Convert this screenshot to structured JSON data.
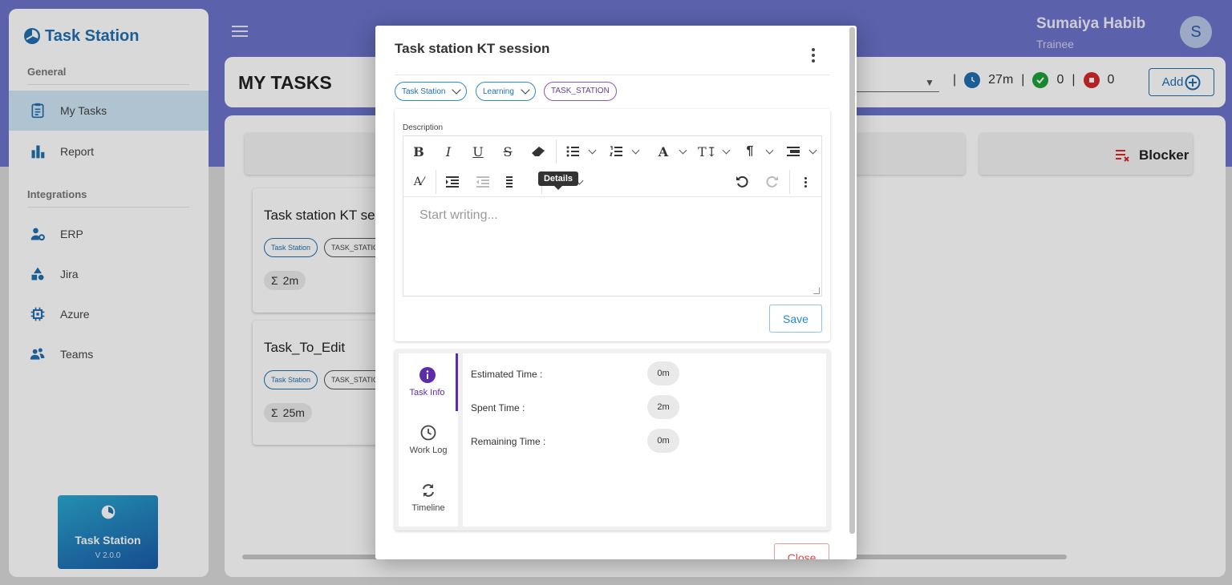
{
  "app": {
    "name": "Task Station",
    "version": "V 2.0.0"
  },
  "sidebar": {
    "sections": [
      {
        "title": "General",
        "items": [
          {
            "label": "My Tasks",
            "icon": "clipboard-icon",
            "active": true
          },
          {
            "label": "Report",
            "icon": "bar-chart-icon"
          }
        ]
      },
      {
        "title": "Integrations",
        "items": [
          {
            "label": "ERP",
            "icon": "user-gear-icon"
          },
          {
            "label": "Jira",
            "icon": "shapes-icon"
          },
          {
            "label": "Azure",
            "icon": "chip-icon"
          },
          {
            "label": "Teams",
            "icon": "team-icon"
          }
        ]
      }
    ]
  },
  "user": {
    "name": "Sumaiya Habib",
    "role": "Trainee",
    "initial": "S"
  },
  "header": {
    "title": "MY TASKS",
    "stats": {
      "time": "27m",
      "done": "0",
      "stopped": "0"
    },
    "add_label": "Add"
  },
  "board": {
    "blocker_label": "Blocker",
    "cards": [
      {
        "title": "Task station KT se",
        "project": "Task Station",
        "tag": "TASK_STATIO",
        "time": "2m"
      },
      {
        "title": "Task_To_Edit",
        "project": "Task Station",
        "tag": "TASK_STATIO",
        "time": "25m"
      }
    ]
  },
  "modal": {
    "title": "Task station KT session",
    "project_select": "Task Station",
    "category_select": "Learning",
    "tag": "TASK_STATION",
    "description_label": "Description",
    "editor_placeholder": "Start writing...",
    "tooltip": "Details",
    "save_label": "Save",
    "close_label": "Close",
    "tabs": [
      {
        "label": "Task Info",
        "icon": "info-icon",
        "active": true
      },
      {
        "label": "Work Log",
        "icon": "clock-icon"
      },
      {
        "label": "Timeline",
        "icon": "sync-icon"
      }
    ],
    "info": [
      {
        "label": "Estimated Time :",
        "value": "0m"
      },
      {
        "label": "Spent Time :",
        "value": "2m"
      },
      {
        "label": "Remaining Time :",
        "value": "0m"
      }
    ]
  },
  "colors": {
    "primary": "#1f6fb0",
    "header_band": "#6b72c9",
    "active_tab": "#5c2da8",
    "danger": "#d84848",
    "success": "#1e9e3a"
  }
}
